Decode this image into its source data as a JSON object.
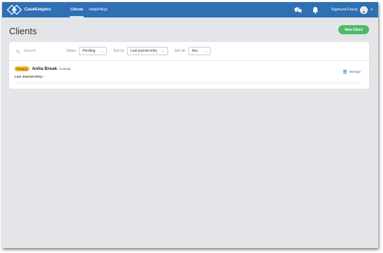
{
  "app": {
    "name": "CaseKeepers"
  },
  "nav": {
    "links": [
      {
        "label": "Clients",
        "active": true
      },
      {
        "label": "Help/FAQs",
        "active": false
      }
    ],
    "user_name": "Sigmund Freud"
  },
  "page": {
    "title": "Clients",
    "new_client_label": "New Client"
  },
  "filters": {
    "search_placeholder": "Search",
    "status_label": "Status",
    "status_value": "Pending",
    "sort_by_label": "Sort by",
    "sort_by_value": "Last journal entry",
    "sort_dir_label": "Sort dir",
    "sort_dir_value": "Asc"
  },
  "clients": [
    {
      "status": "Pending",
      "name": "Anita Break",
      "type": "Custody",
      "journal_label": "Last Journal entry:",
      "journal_value": "-",
      "manage_label": "Manage"
    }
  ],
  "colors": {
    "primary": "#2f6fb3",
    "success": "#4cbb6c",
    "pending": "#f5b51d",
    "background": "#e4e5e8"
  },
  "icons": {
    "chat": "chat-icon",
    "bell": "bell-icon",
    "search": "search-icon",
    "manage": "list-icon"
  }
}
